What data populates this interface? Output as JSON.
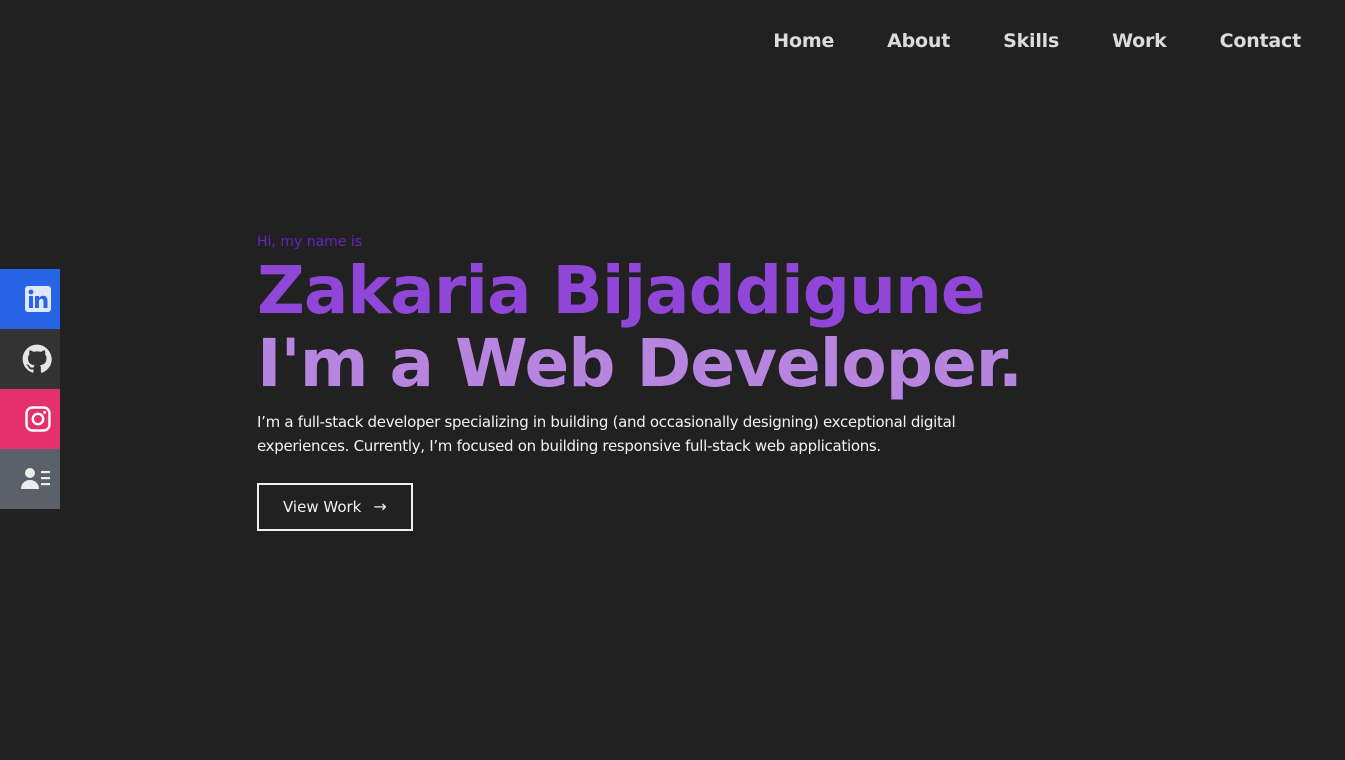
{
  "nav": {
    "items": [
      {
        "label": "Home"
      },
      {
        "label": "About"
      },
      {
        "label": "Skills"
      },
      {
        "label": "Work"
      },
      {
        "label": "Contact"
      }
    ]
  },
  "social": [
    {
      "name": "linkedin-icon",
      "color": "#2864e6"
    },
    {
      "name": "github-icon",
      "color": "#333333"
    },
    {
      "name": "instagram-icon",
      "color": "#e4306c"
    },
    {
      "name": "resume-icon",
      "color": "#5a616b"
    }
  ],
  "hero": {
    "greeting": "Hi, my name is",
    "name": "Zakaria Bijaddigune",
    "role": "I'm a Web Developer.",
    "intro": "I’m a full-stack developer specializing in building (and occasionally designing) exceptional digital experiences. Currently, I’m focused on building responsive full-stack web applications.",
    "cta_label": "View Work",
    "cta_arrow": "→"
  },
  "colors": {
    "background": "#212121",
    "greeting": "#6a1fc4",
    "name": "#9046d6",
    "role": "#b784e0",
    "text": "#f2f2f2"
  }
}
